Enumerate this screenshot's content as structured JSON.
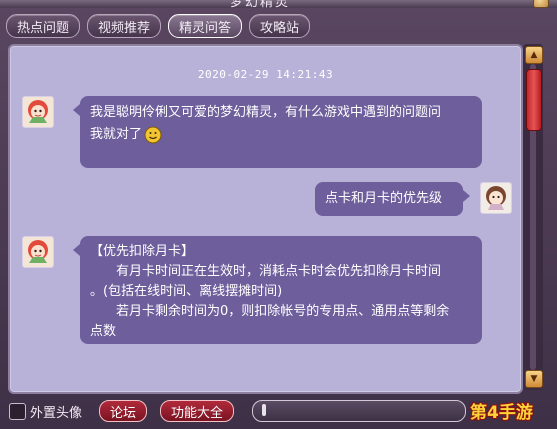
{
  "window": {
    "title": "梦幻精灵"
  },
  "tabs": [
    {
      "label": "热点问题",
      "active": false
    },
    {
      "label": "视频推荐",
      "active": false
    },
    {
      "label": "精灵问答",
      "active": true
    },
    {
      "label": "攻略站",
      "active": false
    }
  ],
  "chat": {
    "timestamp": "2020-02-29 14:21:43",
    "messages": [
      {
        "sender": "sprite",
        "lines": [
          "我是聪明伶俐又可爱的梦幻精灵，有什么游戏中遇到的问题问",
          "我就对了"
        ],
        "emoji": "smile-icon"
      },
      {
        "sender": "player",
        "lines": [
          "点卡和月卡的优先级"
        ]
      },
      {
        "sender": "sprite",
        "lines": [
          "【优先扣除月卡】",
          "　　有月卡时间正在生效时，消耗点卡时会优先扣除月卡时间",
          "。(包括在线时间、离线摆摊时间)",
          "　　若月卡剩余时间为0，则扣除帐号的专用点、通用点等剩余",
          "点数"
        ]
      }
    ]
  },
  "bottom": {
    "checkbox_label": "外置头像",
    "forum_button": "论坛",
    "features_button": "功能大全",
    "chat_input_value": ""
  },
  "watermark": "第4手游",
  "colors": {
    "panel_bg": "#b8b1d8",
    "bubble_bg": "#6e5e9c",
    "accent_red": "#b02a3b",
    "scroll_thumb": "#d33a3f"
  }
}
